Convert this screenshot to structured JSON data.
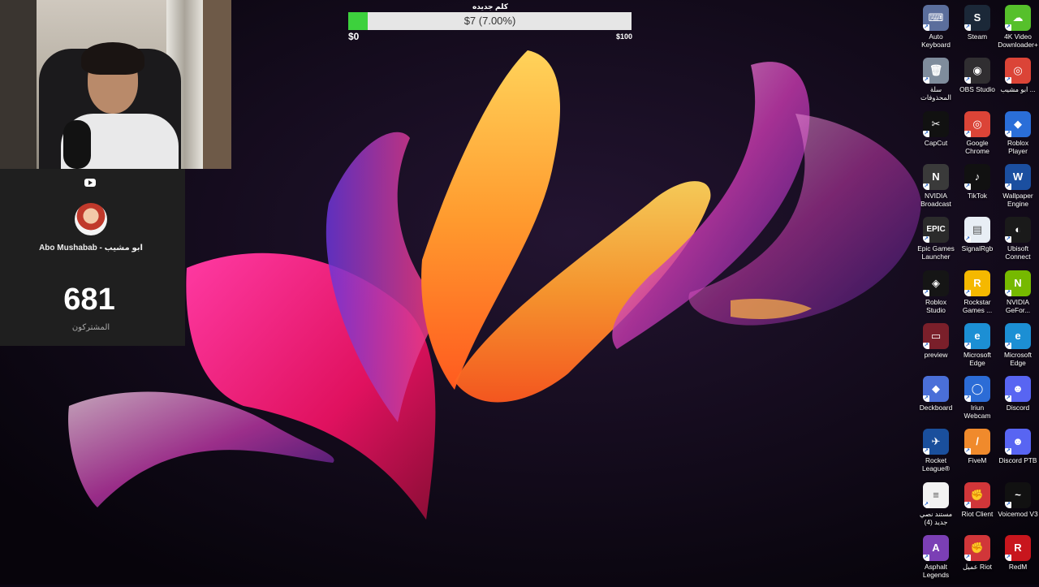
{
  "goal": {
    "title": "كلم جديده",
    "progress_text": "$7 (7.00%)",
    "progress": 0.07,
    "min_label": "$0",
    "max_label": "$100"
  },
  "youtube_card": {
    "channel_name": "Abo Mushabab - ابو مشيب",
    "subscriber_count": "681",
    "subscriber_label": "المشتركون"
  },
  "desktop_icons": [
    {
      "name": "Auto Keyboard",
      "color": "#5b6e9c",
      "glyph": "⌨"
    },
    {
      "name": "Steam",
      "color": "#1b2838",
      "glyph": "S"
    },
    {
      "name": "4K Video Downloader+",
      "color": "#56c02b",
      "glyph": "☁"
    },
    {
      "name": "سلة المحذوفات",
      "color": "#7f8c9c",
      "glyph": "🗑"
    },
    {
      "name": "OBS Studio",
      "color": "#302e31",
      "glyph": "◉"
    },
    {
      "name": "ابو مشيب ...",
      "color": "#db4437",
      "glyph": "◎"
    },
    {
      "name": "CapCut",
      "color": "#111111",
      "glyph": "✂"
    },
    {
      "name": "Google Chrome",
      "color": "#db4437",
      "glyph": "◎"
    },
    {
      "name": "Roblox Player",
      "color": "#2a6ed8",
      "glyph": "◆"
    },
    {
      "name": "NVIDIA Broadcast",
      "color": "#3a3a3a",
      "glyph": "N"
    },
    {
      "name": "TikTok",
      "color": "#111111",
      "glyph": "♪"
    },
    {
      "name": "Wallpaper Engine",
      "color": "#1b4fa0",
      "glyph": "W"
    },
    {
      "name": "Epic Games Launcher",
      "color": "#2b2b2b",
      "glyph": "EPIC"
    },
    {
      "name": "SignalRgb",
      "color": "#e8eef5",
      "glyph": "▤"
    },
    {
      "name": "Ubisoft Connect",
      "color": "#1a1a1a",
      "glyph": "◐"
    },
    {
      "name": "Roblox Studio",
      "color": "#151515",
      "glyph": "◈"
    },
    {
      "name": "Rockstar Games ...",
      "color": "#f5b800",
      "glyph": "R"
    },
    {
      "name": "NVIDIA GeFor...",
      "color": "#76b900",
      "glyph": "N"
    },
    {
      "name": "preview",
      "color": "#7a1f2a",
      "glyph": "▭"
    },
    {
      "name": "Microsoft Edge",
      "color": "#1c8fd4",
      "glyph": "e"
    },
    {
      "name": "Microsoft Edge",
      "color": "#1c8fd4",
      "glyph": "e"
    },
    {
      "name": "Deckboard",
      "color": "#4a6fd8",
      "glyph": "◆"
    },
    {
      "name": "Iriun Webcam",
      "color": "#2c6cd6",
      "glyph": "◯"
    },
    {
      "name": "Discord",
      "color": "#5865f2",
      "glyph": "☻"
    },
    {
      "name": "Rocket League®",
      "color": "#1a4f9c",
      "glyph": "✈"
    },
    {
      "name": "FiveM",
      "color": "#f08a2c",
      "glyph": "/"
    },
    {
      "name": "Discord PTB",
      "color": "#5865f2",
      "glyph": "☻"
    },
    {
      "name": "مستند نصي جديد (4)",
      "color": "#f2f2f2",
      "glyph": "≡"
    },
    {
      "name": "Riot Client",
      "color": "#d13639",
      "glyph": "✊"
    },
    {
      "name": "Voicemod V3",
      "color": "#111111",
      "glyph": "~"
    },
    {
      "name": "Asphalt Legends",
      "color": "#7b3fb5",
      "glyph": "A"
    },
    {
      "name": "عميل Riot",
      "color": "#d13639",
      "glyph": "✊"
    },
    {
      "name": "RedM",
      "color": "#c8161d",
      "glyph": "R"
    }
  ]
}
